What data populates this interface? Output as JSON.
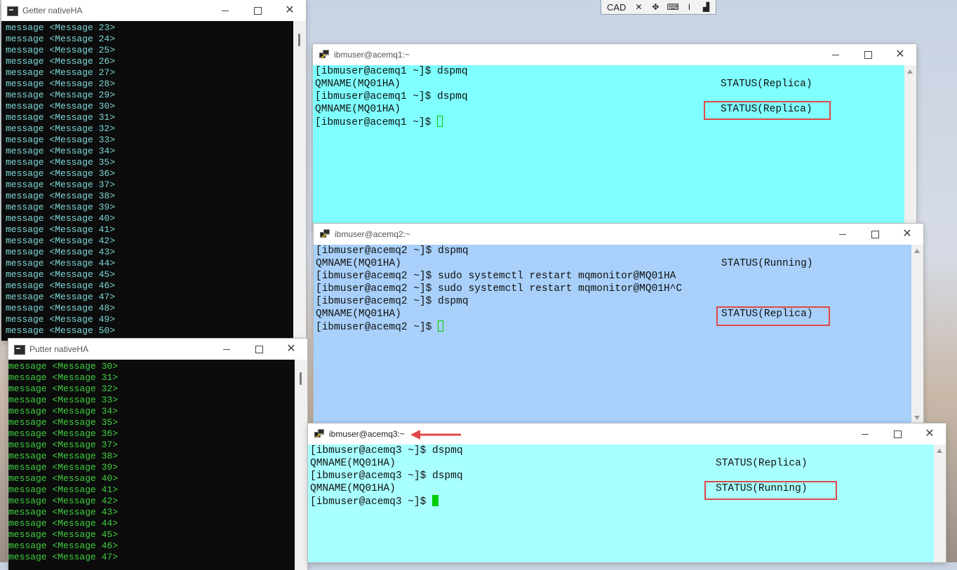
{
  "remote_toolbar": {
    "cad_label": "CAD",
    "icons": [
      "shrink-icon",
      "expand-icon",
      "keyboard-icon",
      "text-cursor-icon",
      "signal-icon"
    ]
  },
  "getter_window": {
    "title": "Getter nativeHA",
    "text_color": "#7fd7d7",
    "lines": [
      "message <Message 23>",
      "message <Message 24>",
      "message <Message 25>",
      "message <Message 26>",
      "message <Message 27>",
      "message <Message 28>",
      "message <Message 29>",
      "message <Message 30>",
      "message <Message 31>",
      "message <Message 32>",
      "message <Message 33>",
      "message <Message 34>",
      "message <Message 35>",
      "message <Message 36>",
      "message <Message 37>",
      "message <Message 38>",
      "message <Message 39>",
      "message <Message 40>",
      "message <Message 41>",
      "message <Message 42>",
      "message <Message 43>",
      "message <Message 44>",
      "message <Message 45>",
      "message <Message 46>",
      "message <Message 47>",
      "message <Message 48>",
      "message <Message 49>",
      "message <Message 50>"
    ]
  },
  "putter_window": {
    "title": "Putter nativeHA",
    "text_color": "#3ecf3e",
    "lines": [
      "message <Message 30>",
      "message <Message 31>",
      "message <Message 32>",
      "message <Message 33>",
      "message <Message 34>",
      "message <Message 35>",
      "message <Message 36>",
      "message <Message 37>",
      "message <Message 38>",
      "message <Message 39>",
      "message <Message 40>",
      "message <Message 41>",
      "message <Message 42>",
      "message <Message 43>",
      "message <Message 44>",
      "message <Message 45>",
      "message <Message 46>",
      "message <Message 47>"
    ]
  },
  "acemq1_window": {
    "title": "ibmuser@acemq1:~",
    "bg": "#7fffff",
    "lines": [
      {
        "text": "[ibmuser@acemq1 ~]$ dspmq",
        "status": ""
      },
      {
        "text": "QMNAME(MQ01HA)",
        "status": "STATUS(Replica)"
      },
      {
        "text": "[ibmuser@acemq1 ~]$ dspmq",
        "status": ""
      },
      {
        "text": "QMNAME(MQ01HA)",
        "status": "STATUS(Replica)"
      },
      {
        "text": "[ibmuser@acemq1 ~]$ ",
        "status": ""
      }
    ]
  },
  "acemq2_window": {
    "title": "ibmuser@acemq2:~",
    "bg": "#a8d0fa",
    "lines": [
      {
        "text": "[ibmuser@acemq2 ~]$ dspmq",
        "status": ""
      },
      {
        "text": "QMNAME(MQ01HA)",
        "status": "STATUS(Running)"
      },
      {
        "text": "[ibmuser@acemq2 ~]$ sudo systemctl restart mqmonitor@MQ01HA",
        "status": ""
      },
      {
        "text": "[ibmuser@acemq2 ~]$ sudo systemctl restart mqmonitor@MQ01H^C",
        "status": ""
      },
      {
        "text": "[ibmuser@acemq2 ~]$ dspmq",
        "status": ""
      },
      {
        "text": "QMNAME(MQ01HA)",
        "status": "STATUS(Replica)"
      },
      {
        "text": "[ibmuser@acemq2 ~]$ ",
        "status": ""
      }
    ]
  },
  "acemq3_window": {
    "title": "ibmuser@acemq3:~",
    "bg": "#a8ffff",
    "lines": [
      {
        "text": "[ibmuser@acemq3 ~]$ dspmq",
        "status": ""
      },
      {
        "text": "QMNAME(MQ01HA)",
        "status": "STATUS(Replica)"
      },
      {
        "text": "[ibmuser@acemq3 ~]$ dspmq",
        "status": ""
      },
      {
        "text": "QMNAME(MQ01HA)",
        "status": "STATUS(Running)"
      },
      {
        "text": "[ibmuser@acemq3 ~]$ ",
        "status": ""
      }
    ]
  },
  "colors": {
    "highlight_box": "#e04848",
    "cursor": "#00cc00"
  }
}
